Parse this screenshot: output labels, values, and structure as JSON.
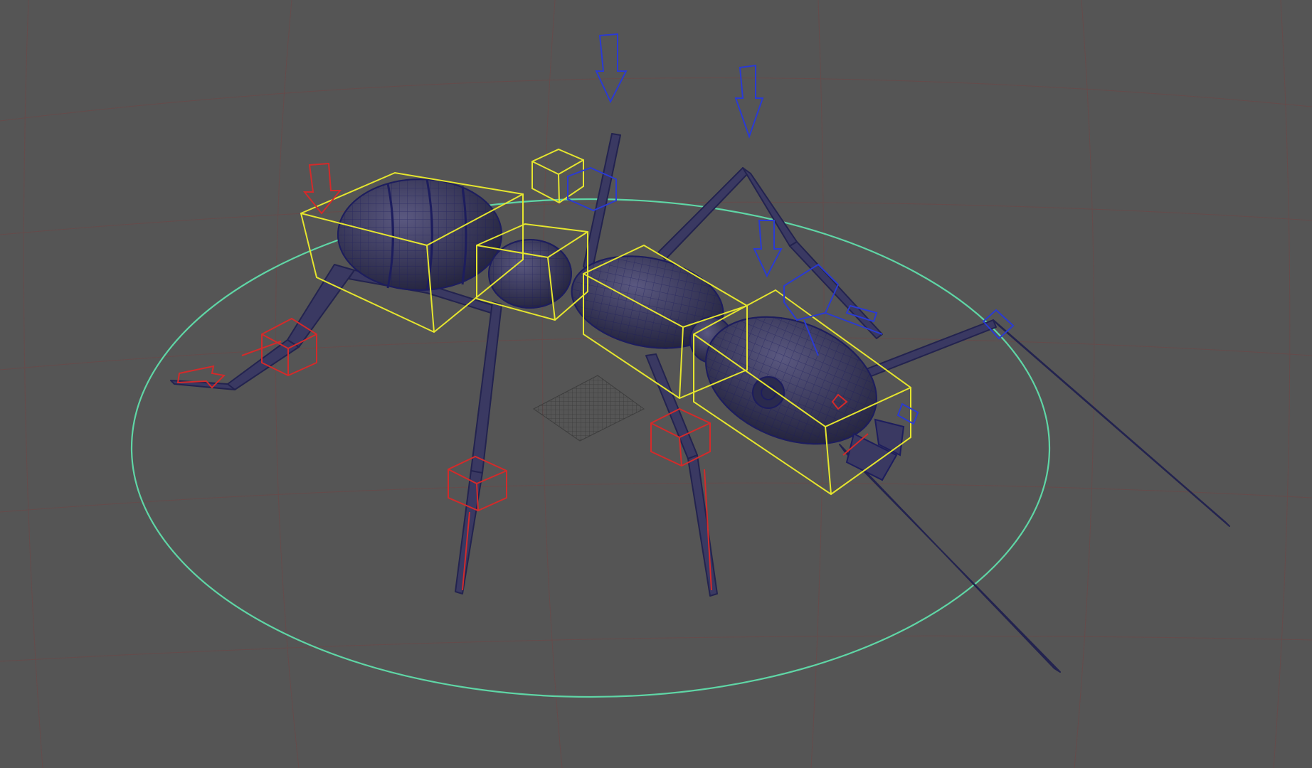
{
  "viewport": {
    "background_color": "#555555",
    "grid_color": "#6e4a4a",
    "ground_grid_color": "#3a3a3a"
  },
  "colors": {
    "mesh_fill": "#3c3a5a",
    "mesh_wire": "#1d1d5e",
    "mesh_edge": "#26266c",
    "ik_control": "#e5e52e",
    "fk_control_left": "#d42a2a",
    "fk_control_right": "#2a3ad4",
    "world_circle": "#5fd6a6"
  },
  "scene": {
    "object": "ant",
    "controls": [
      "world-circle-control",
      "body-box-controls",
      "leg-fk-controls",
      "pole-vector-arrows"
    ]
  }
}
